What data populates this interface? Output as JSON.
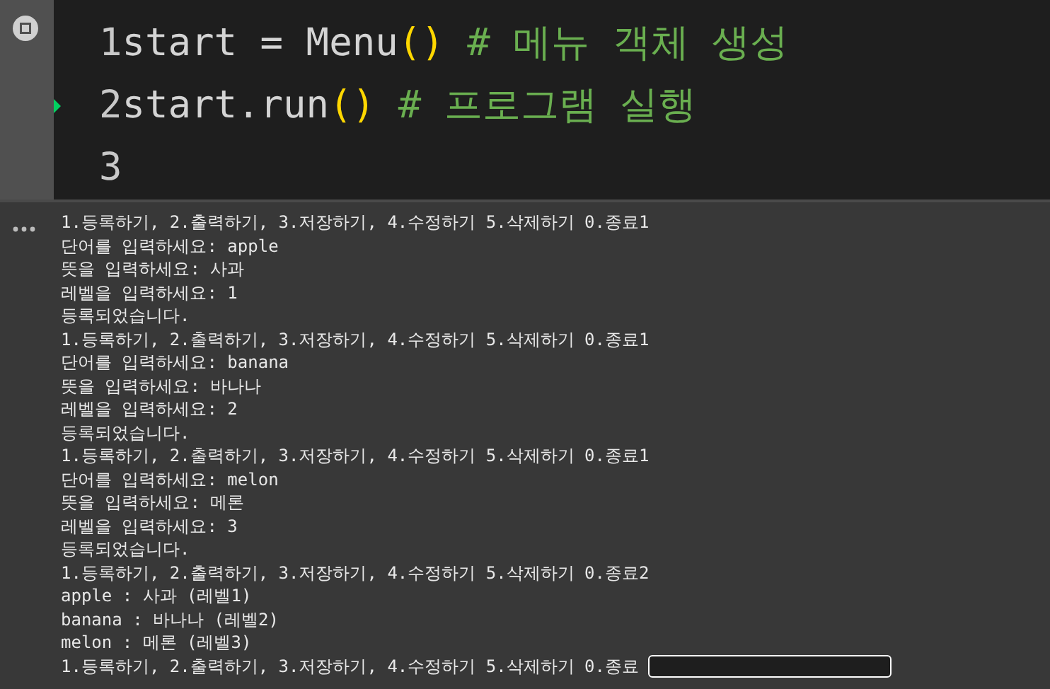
{
  "code_cell": {
    "lines": [
      {
        "number": "1",
        "tokens": [
          {
            "kind": "plain",
            "text": "start = Menu"
          },
          {
            "kind": "paren",
            "text": "()"
          },
          {
            "kind": "comment",
            "text": " # 메뉴 객체 생성"
          }
        ]
      },
      {
        "number": "2",
        "current": true,
        "tokens": [
          {
            "kind": "plain",
            "text": "start.run"
          },
          {
            "kind": "paren",
            "text": "()"
          },
          {
            "kind": "comment",
            "text": " # 프로그램 실행"
          }
        ]
      },
      {
        "number": "3"
      }
    ]
  },
  "output": {
    "lines": [
      {
        "kind": "text",
        "text": "1.등록하기, 2.출력하기, 3.저장하기, 4.수정하기 5.삭제하기 0.종료1"
      },
      {
        "kind": "text",
        "text": "단어를 입력하세요: apple"
      },
      {
        "kind": "text",
        "text": "뜻을 입력하세요: 사과"
      },
      {
        "kind": "text",
        "text": "레벨을 입력하세요: 1"
      },
      {
        "kind": "text",
        "text": "등록되었습니다."
      },
      {
        "kind": "text",
        "text": "1.등록하기, 2.출력하기, 3.저장하기, 4.수정하기 5.삭제하기 0.종료1"
      },
      {
        "kind": "text",
        "text": "단어를 입력하세요: banana"
      },
      {
        "kind": "text",
        "text": "뜻을 입력하세요: 바나나"
      },
      {
        "kind": "text",
        "text": "레벨을 입력하세요: 2"
      },
      {
        "kind": "text",
        "text": "등록되었습니다."
      },
      {
        "kind": "text",
        "text": "1.등록하기, 2.출력하기, 3.저장하기, 4.수정하기 5.삭제하기 0.종료1"
      },
      {
        "kind": "text",
        "text": "단어를 입력하세요: melon"
      },
      {
        "kind": "text",
        "text": "뜻을 입력하세요: 메론"
      },
      {
        "kind": "text",
        "text": "레벨을 입력하세요: 3"
      },
      {
        "kind": "text",
        "text": "등록되었습니다."
      },
      {
        "kind": "text",
        "text": "1.등록하기, 2.출력하기, 3.저장하기, 4.수정하기 5.삭제하기 0.종료2"
      },
      {
        "kind": "text",
        "text": "apple : 사과 (레벨1)"
      },
      {
        "kind": "text",
        "text": "banana : 바나나 (레벨2)"
      },
      {
        "kind": "text",
        "text": "melon : 메론 (레벨3)"
      },
      {
        "kind": "prompt",
        "text": "1.등록하기, 2.출력하기, 3.저장하기, 4.수정하기 5.삭제하기 0.종료"
      }
    ]
  }
}
